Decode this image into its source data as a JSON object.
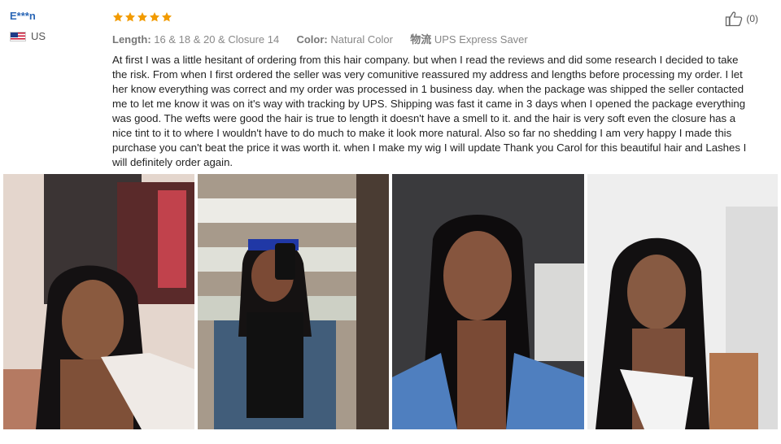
{
  "reviewer": {
    "name": "E***n",
    "country": "US"
  },
  "rating": {
    "stars": 5,
    "star_color": "#f29b00"
  },
  "meta": {
    "length_label": "Length:",
    "length_value": "16 & 18 & 20 & Closure 14",
    "color_label": "Color:",
    "color_value": "Natural Color",
    "shipping_label": "物流",
    "shipping_value": "UPS Express Saver"
  },
  "helpful": {
    "count": "(0)",
    "icon": "thumbs-up-icon"
  },
  "review_text": "At first I was a little hesitant of ordering from this hair company. but when I read the reviews and did some research I decided to take the risk. From when I first ordered the seller was very comunitive reassured my address and lengths before processing my order. I let her know everything was correct and my order was processed in 1 business day. when the package was shipped the seller contacted me to let me know it was on it's way with tracking by UPS. Shipping was fast it came in 3 days when I opened the package everything was good. The wefts were good the hair is true to length it doesn't have a smell to it. and the hair is very soft even the closure has a nice tint to it to where I wouldn't have to do much to make it look more natural. Also so far no shedding I am very happy I made this purchase you can't beat the price it was worth it. when I make my wig I will update Thank you Carol for this beautiful hair and Lashes I will definitely order again.",
  "photos": [
    {
      "label": "customer-photo-1"
    },
    {
      "label": "customer-photo-2"
    },
    {
      "label": "customer-photo-3"
    },
    {
      "label": "customer-photo-4"
    }
  ],
  "colors": {
    "name_blue": "#2b67b6",
    "meta_gray": "#888888",
    "text": "#222222"
  }
}
